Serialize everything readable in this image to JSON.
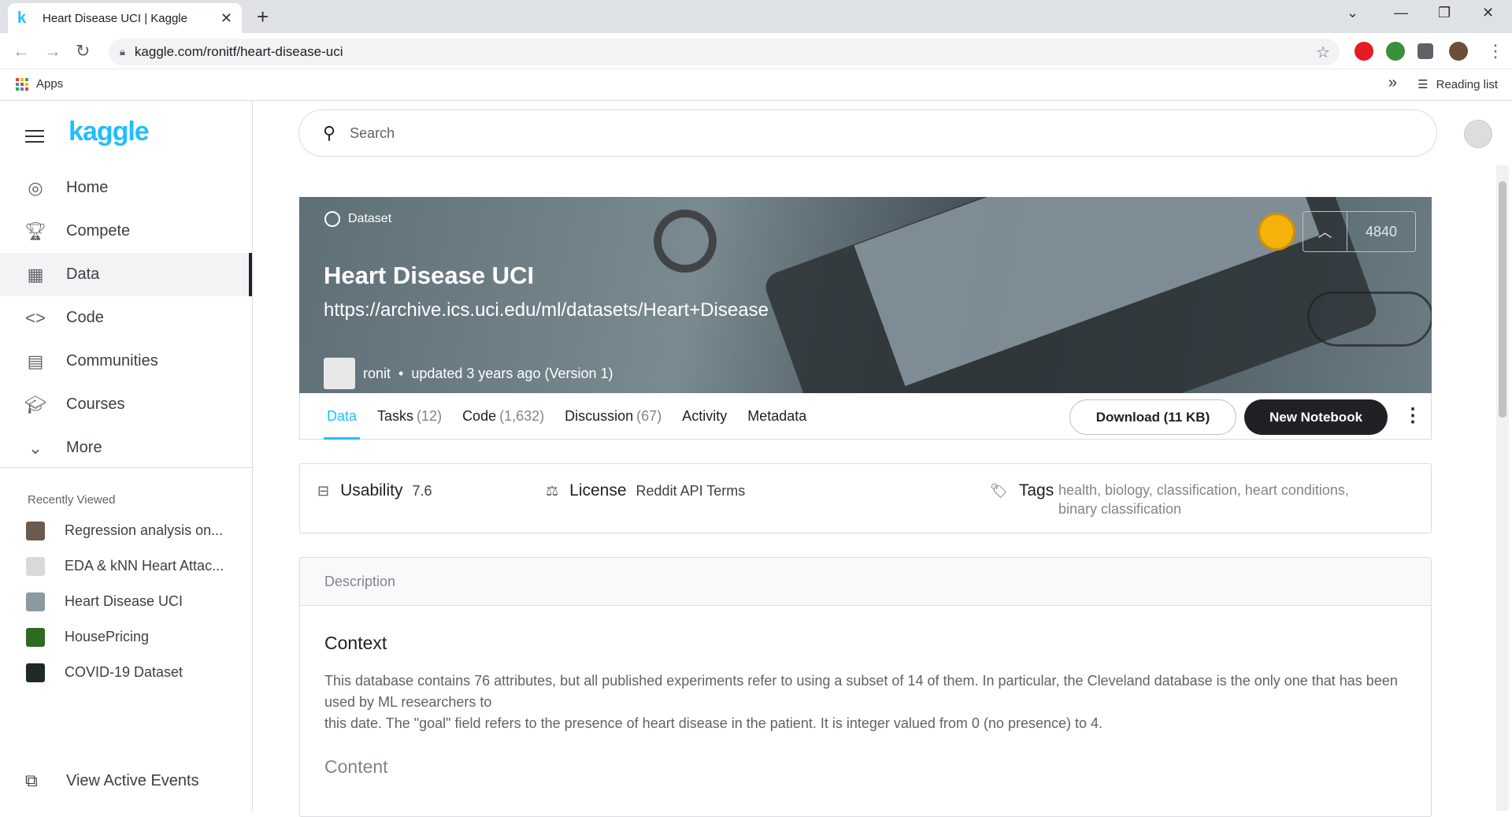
{
  "browser": {
    "tab_title": "Heart Disease UCI | Kaggle",
    "url": "kaggle.com/ronitf/heart-disease-uci",
    "bookmarks": {
      "apps": "Apps",
      "reading_list": "Reading list"
    }
  },
  "sidebar": {
    "logo": "kaggle",
    "nav": [
      {
        "label": "Home",
        "icon": "compass-icon"
      },
      {
        "label": "Compete",
        "icon": "trophy-icon"
      },
      {
        "label": "Data",
        "icon": "table-icon"
      },
      {
        "label": "Code",
        "icon": "code-icon"
      },
      {
        "label": "Communities",
        "icon": "chat-icon"
      },
      {
        "label": "Courses",
        "icon": "school-icon"
      },
      {
        "label": "More",
        "icon": "chevron-down-icon"
      }
    ],
    "recently_viewed_title": "Recently Viewed",
    "recently_viewed": [
      "Regression analysis on...",
      "EDA & kNN Heart Attac...",
      "Heart Disease UCI",
      "HousePricing",
      "COVID-19 Dataset"
    ],
    "view_active_events": "View Active Events"
  },
  "search": {
    "placeholder": "Search"
  },
  "dataset": {
    "type_label": "Dataset",
    "title": "Heart Disease UCI",
    "subtitle": "https://archive.ics.uci.edu/ml/datasets/Heart+Disease",
    "author": "ronit",
    "updated": "updated 3 years ago (Version 1)",
    "votes": "4840"
  },
  "tabs": [
    {
      "label": "Data",
      "count": ""
    },
    {
      "label": "Tasks",
      "count": "(12)"
    },
    {
      "label": "Code",
      "count": "(1,632)"
    },
    {
      "label": "Discussion",
      "count": "(67)"
    },
    {
      "label": "Activity",
      "count": ""
    },
    {
      "label": "Metadata",
      "count": ""
    }
  ],
  "actions": {
    "download": "Download (11 KB)",
    "new_notebook": "New Notebook"
  },
  "info": {
    "usability_label": "Usability",
    "usability_value": "7.6",
    "license_label": "License",
    "license_value": "Reddit API Terms",
    "tags_label": "Tags",
    "tags_line1": "health, biology, classification, heart conditions,",
    "tags_line2": "binary classification"
  },
  "description": {
    "header": "Description",
    "context_title": "Context",
    "context_line1": "This database contains 76 attributes, but all published experiments refer to using a subset of 14 of them. In particular, the Cleveland database is the only one that has been used by ML researchers to",
    "context_line2": "this date. The \"goal\" field refers to the presence of heart disease in the patient. It is integer valued from 0 (no presence) to 4.",
    "content_title": "Content"
  },
  "colors": {
    "accent": "#20beff",
    "dark": "#202124"
  }
}
